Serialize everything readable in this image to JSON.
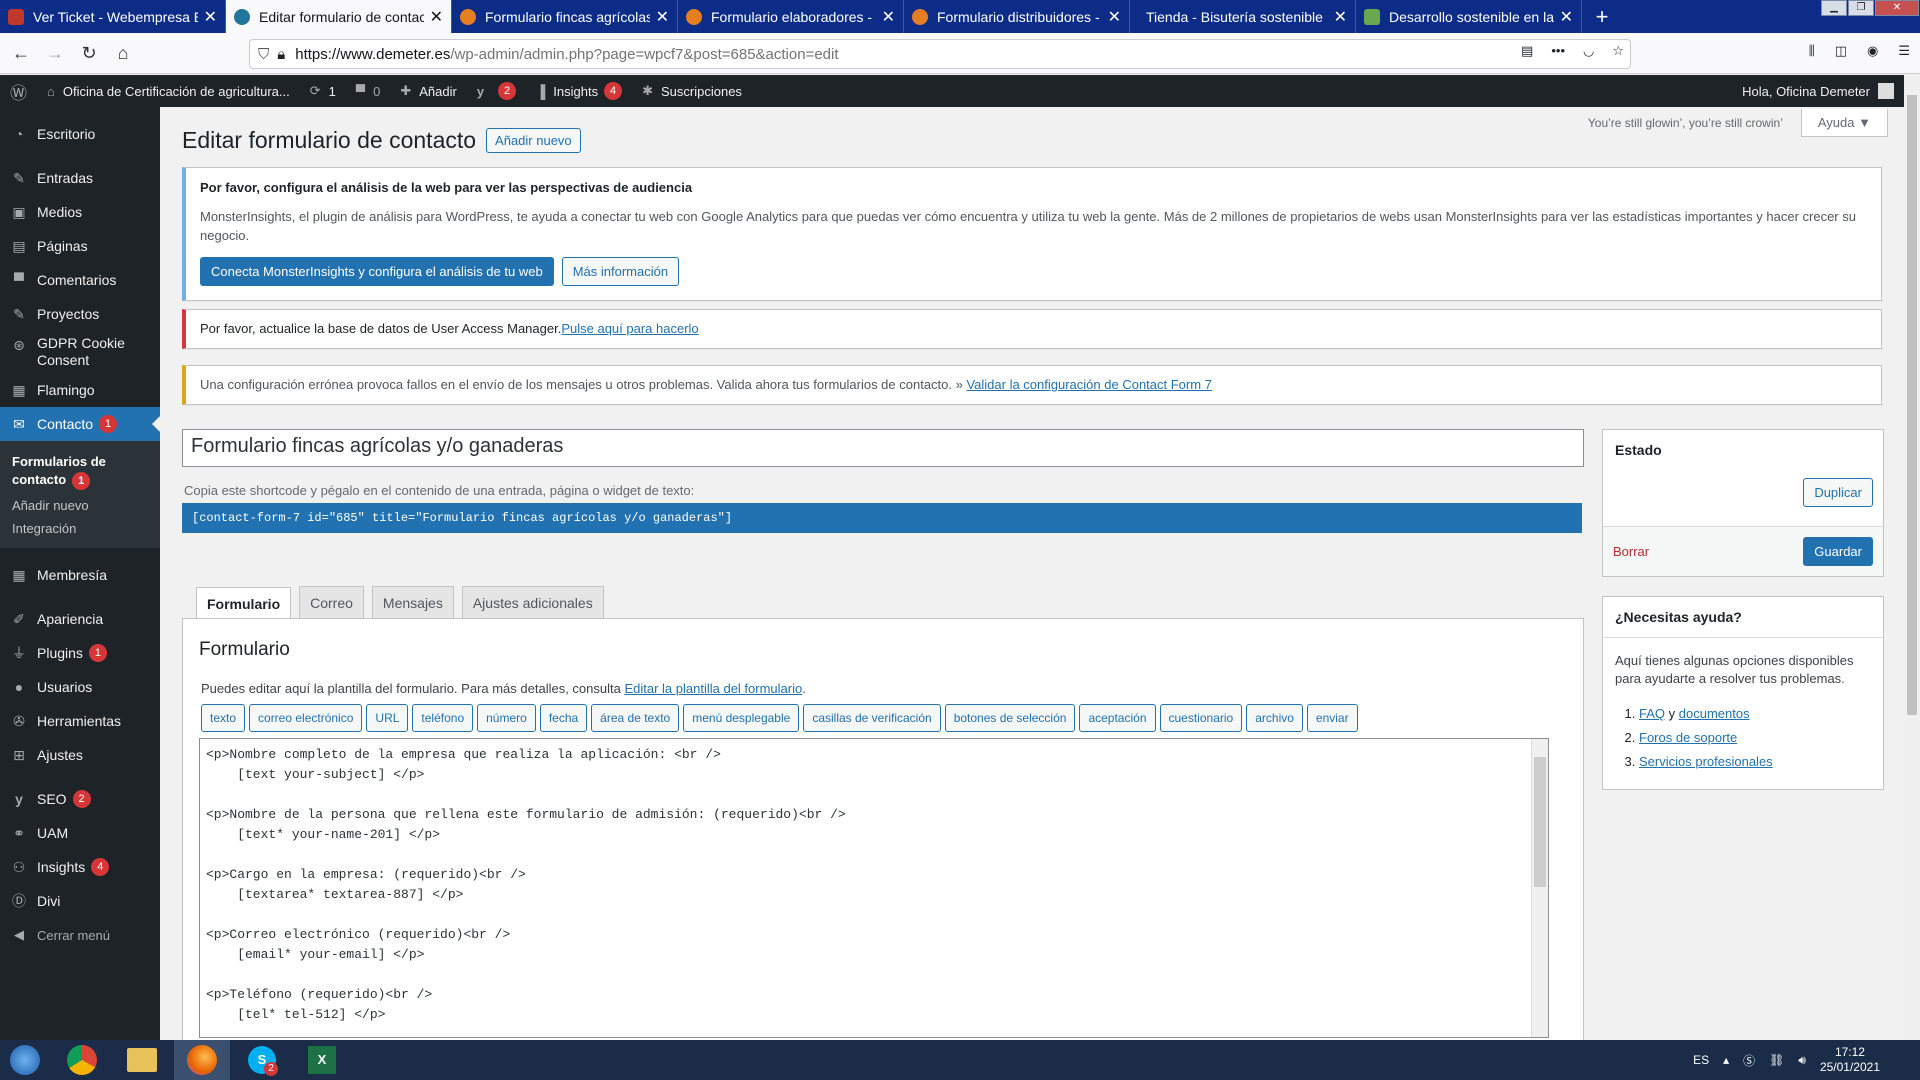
{
  "browser": {
    "tabs": [
      {
        "title": "Ver Ticket - Webempresa Europ",
        "favicon_color": "#c0392b",
        "active": false
      },
      {
        "title": "Editar formulario de contacto ‹",
        "favicon_color": "#21759b",
        "active": true
      },
      {
        "title": "Formulario fincas agrícolas y/o",
        "favicon_color": "#e67e22",
        "active": false
      },
      {
        "title": "Formulario elaboradores - Ofic",
        "favicon_color": "#e67e22",
        "active": false
      },
      {
        "title": "Formulario distribuidores - Ofi",
        "favicon_color": "#e67e22",
        "active": false
      },
      {
        "title": "Tienda - Bisutería sostenible",
        "favicon_color": "",
        "active": false
      },
      {
        "title": "Desarrollo sostenible en la sier",
        "favicon_color": "#6aa84f",
        "active": false
      }
    ],
    "url_host": "https://www.demeter.es",
    "url_path": "/wp-admin/admin.php?page=wpcf7&post=685&action=edit"
  },
  "adminbar": {
    "site_name": "Oficina de Certificación de agricultura...",
    "updates_count": "1",
    "comments_count": "0",
    "add_new": "Añadir",
    "yoast_badge": "2",
    "insights": "Insights",
    "insights_badge": "4",
    "subscriptions": "Suscripciones",
    "greeting": "Hola, Oficina Demeter"
  },
  "sidebar": {
    "items": [
      {
        "label": "Escritorio",
        "icon": "dashboard-icon"
      },
      {
        "label": "Entradas",
        "icon": "pin-icon"
      },
      {
        "label": "Medios",
        "icon": "media-icon"
      },
      {
        "label": "Páginas",
        "icon": "pages-icon"
      },
      {
        "label": "Comentarios",
        "icon": "comment-icon"
      },
      {
        "label": "Proyectos",
        "icon": "pin-icon"
      },
      {
        "label": "GDPR Cookie Consent",
        "icon": "cookie-icon"
      },
      {
        "label": "Flamingo",
        "icon": "flamingo-icon"
      },
      {
        "label": "Contacto",
        "icon": "mail-icon",
        "badge": "1"
      }
    ],
    "submenu": {
      "forms": "Formularios de contacto",
      "forms_badge": "1",
      "add_new": "Añadir nuevo",
      "integration": "Integración"
    },
    "items2": [
      {
        "label": "Membresía",
        "icon": "membership-icon"
      },
      {
        "label": "Apariencia",
        "icon": "appearance-icon"
      },
      {
        "label": "Plugins",
        "icon": "plugin-icon",
        "badge": "1"
      },
      {
        "label": "Usuarios",
        "icon": "users-icon"
      },
      {
        "label": "Herramientas",
        "icon": "tools-icon"
      },
      {
        "label": "Ajustes",
        "icon": "settings-icon"
      },
      {
        "label": "SEO",
        "icon": "yoast-icon",
        "badge": "2"
      },
      {
        "label": "UAM",
        "icon": "uam-icon"
      },
      {
        "label": "Insights",
        "icon": "insights-icon",
        "badge": "4"
      },
      {
        "label": "Divi",
        "icon": "divi-icon"
      },
      {
        "label": "Cerrar menú",
        "icon": "collapse-icon"
      }
    ]
  },
  "header": {
    "dolly": "You’re still glowin’, you’re still crowin’",
    "help": "Ayuda",
    "title": "Editar formulario de contacto",
    "add_new": "Añadir nuevo"
  },
  "notices": {
    "mi_title": "Por favor, configura el análisis de la web para ver las perspectivas de audiencia",
    "mi_text": "MonsterInsights, el plugin de análisis para WordPress, te ayuda a conectar tu web con Google Analytics para que puedas ver cómo encuentra y utiliza tu web la gente. Más de 2 millones de propietarios de webs usan MonsterInsights para ver las estadísticas importantes y hacer crecer su negocio.",
    "mi_button": "Conecta MonsterInsights y configura el análisis de tu web",
    "mi_more": "Más información",
    "uam_text": "Por favor, actualice la base de datos de User Access Manager.",
    "uam_link": "Pulse aquí para hacerlo",
    "cf7_text": "Una configuración errónea provoca fallos en el envío de los mensajes u otros problemas. Valida ahora tus formularios de contacto. » ",
    "cf7_link": "Validar la configuración de Contact Form 7"
  },
  "form": {
    "title": "Formulario fincas agrícolas y/o ganaderas",
    "shortcode_label": "Copia este shortcode y pégalo en el contenido de una entrada, página o widget de texto:",
    "shortcode": "[contact-form-7 id=\"685\" title=\"Formulario fincas agrícolas y/o ganaderas\"]"
  },
  "status_box": {
    "title": "Estado",
    "duplicate": "Duplicar",
    "delete": "Borrar",
    "save": "Guardar"
  },
  "help_box": {
    "title": "¿Necesitas ayuda?",
    "text": "Aquí tienes algunas opciones disponibles para ayudarte a resolver tus problemas.",
    "faq": "FAQ",
    "and": " y ",
    "docs": "documentos",
    "forums": "Foros de soporte",
    "services": "Servicios profesionales"
  },
  "tabs": [
    "Formulario",
    "Correo",
    "Mensajes",
    "Ajustes adicionales"
  ],
  "panel": {
    "heading": "Formulario",
    "desc": "Puedes editar aquí la plantilla del formulario. Para más detalles, consulta ",
    "desc_link": "Editar la plantilla del formulario",
    "tag_buttons": [
      "texto",
      "correo electrónico",
      "URL",
      "teléfono",
      "número",
      "fecha",
      "área de texto",
      "menú desplegable",
      "casillas de verificación",
      "botones de selección",
      "aceptación",
      "cuestionario",
      "archivo",
      "enviar"
    ],
    "code": "<p>Nombre completo de la empresa que realiza la aplicación: <br />\n    [text your-subject] </p>\n\n<p>Nombre de la persona que rellena este formulario de admisión: (requerido)<br />\n    [text* your-name-201] </p>\n\n<p>Cargo en la empresa: (requerido)<br />\n    [textarea* textarea-887] </p>\n\n<p>Correo electrónico (requerido)<br />\n    [email* your-email] </p>\n\n<p>Teléfono (requerido)<br />\n    [tel* tel-512] </p>"
  },
  "taskbar": {
    "lang": "ES",
    "time": "17:12",
    "date": "25/01/2021",
    "skype_badge": "2"
  },
  "colors": {
    "wp_blue": "#2271b1",
    "wp_dark": "#1d2327",
    "badge_red": "#d63638"
  }
}
